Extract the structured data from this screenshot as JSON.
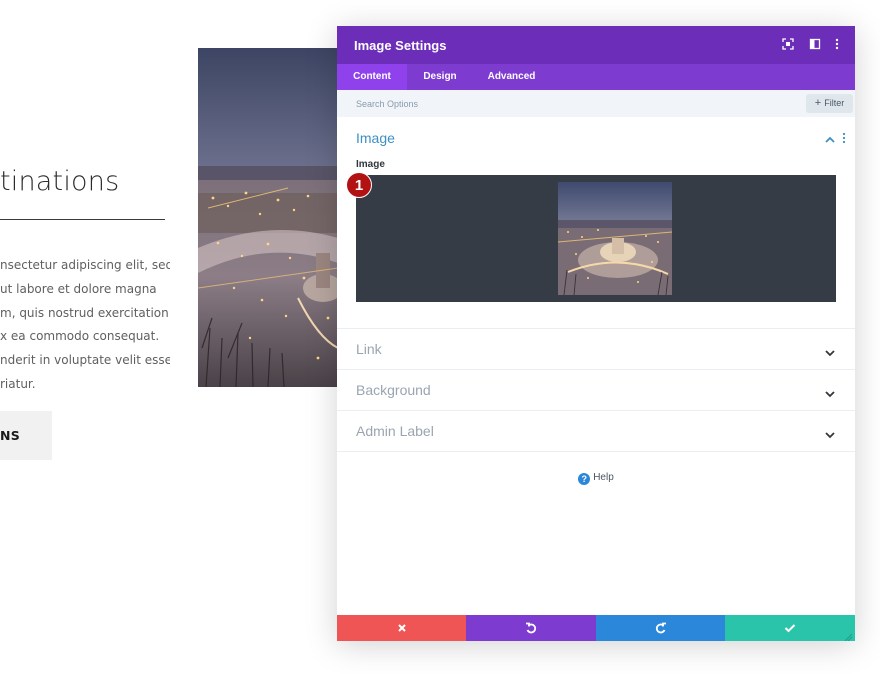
{
  "background_page": {
    "heading": "tinations",
    "paragraph_lines": [
      "nsectetur adipiscing elit, sed",
      "ut labore et dolore magna",
      "m, quis nostrud exercitation",
      "x ea commodo consequat.",
      "nderit in voluptate velit esse",
      "riatur."
    ],
    "button_label": "NS"
  },
  "modal": {
    "title": "Image Settings",
    "header_icons": [
      "fullscreen-icon",
      "split-view-icon",
      "more-options-icon"
    ],
    "tabs": [
      {
        "label": "Content",
        "active": true
      },
      {
        "label": "Design",
        "active": false
      },
      {
        "label": "Advanced",
        "active": false
      }
    ],
    "search": {
      "placeholder": "Search Options",
      "value": ""
    },
    "filter_label": "Filter",
    "image_section": {
      "title": "Image",
      "field_label": "Image"
    },
    "badge_number": "1",
    "sections": [
      {
        "label": "Link"
      },
      {
        "label": "Background"
      },
      {
        "label": "Admin Label"
      }
    ],
    "help_label": "Help",
    "footer": [
      {
        "action": "cancel",
        "icon": "close-icon",
        "color": "#ef5555"
      },
      {
        "action": "undo",
        "icon": "undo-icon",
        "color": "#7e3bd0"
      },
      {
        "action": "redo",
        "icon": "redo-icon",
        "color": "#2b87da"
      },
      {
        "action": "save",
        "icon": "check-icon",
        "color": "#29c4a9"
      }
    ]
  },
  "colors": {
    "header": "#6c2eb9",
    "tabs": "#7e3bd0",
    "active_tab": "#8f42ec",
    "section_title": "#3d8fc4",
    "badge": "#b31212"
  }
}
